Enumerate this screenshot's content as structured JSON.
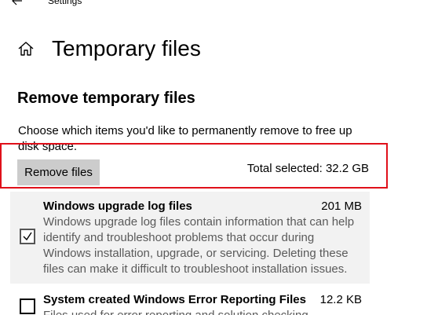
{
  "window": {
    "app_title": "Settings",
    "back_icon": "back-arrow-icon"
  },
  "header": {
    "home_icon": "home-icon",
    "title": "Temporary files"
  },
  "section": {
    "title": "Remove temporary files",
    "description": "Choose which items you'd like to permanently remove to free up disk space."
  },
  "actions": {
    "remove_label": "Remove files",
    "total_selected": "Total selected: 32.2 GB"
  },
  "highlight_color": "#e0101a",
  "items": [
    {
      "name": "Windows upgrade log files",
      "size": "201 MB",
      "checked": true,
      "description": "Windows upgrade log files contain information that can help identify and troubleshoot problems that occur during Windows installation, upgrade, or servicing.  Deleting these files can make it difficult to troubleshoot installation issues."
    },
    {
      "name": "System created Windows Error Reporting Files",
      "size": "12.2 KB",
      "checked": false,
      "description": "Files used for error reporting and solution checking."
    }
  ]
}
